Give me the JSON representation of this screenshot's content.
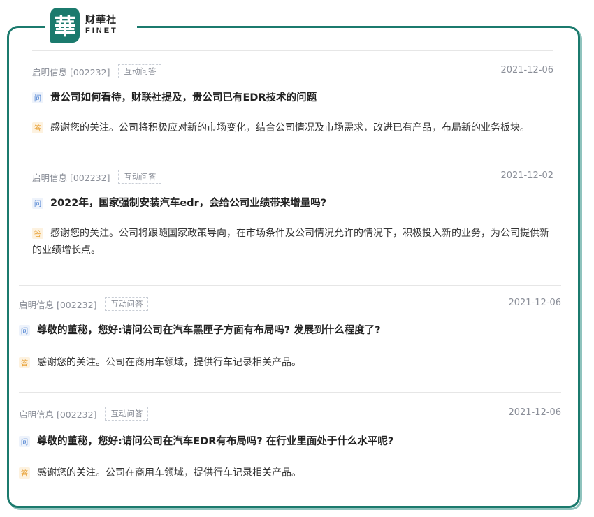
{
  "brand": {
    "mark": "華",
    "name_cn": "财華社",
    "name_en": "FINET"
  },
  "tag_icons": {
    "question": "问",
    "answer": "答"
  },
  "items": [
    {
      "source": "启明信息 [002232]",
      "tag": "互动问答",
      "date": "2021-12-06",
      "question": "贵公司如何看待，财联社提及，贵公司已有EDR技术的问题",
      "answer": "感谢您的关注。公司将积极应对新的市场变化，结合公司情况及市场需求，改进已有产品，布局新的业务板块。"
    },
    {
      "source": "启明信息 [002232]",
      "tag": "互动问答",
      "date": "2021-12-02",
      "question": "2022年，国家强制安装汽车edr，会给公司业绩带来增量吗?",
      "answer": "感谢您的关注。公司将跟随国家政策导向，在市场条件及公司情况允许的情况下，积极投入新的业务，为公司提供新的业绩增长点。"
    },
    {
      "source": "启明信息 [002232]",
      "tag": "互动问答",
      "date": "2021-12-06",
      "question": "尊敬的董秘，您好:请问公司在汽车黑匣子方面有布局吗? 发展到什么程度了?",
      "answer": "感谢您的关注。公司在商用车领域，提供行车记录相关产品。"
    },
    {
      "source": "启明信息 [002232]",
      "tag": "互动问答",
      "date": "2021-12-06",
      "question": "尊敬的董秘，您好:请问公司在汽车EDR有布局吗? 在行业里面处于什么水平呢?",
      "answer": "感谢您的关注。公司在商用车领域，提供行车记录相关产品。"
    }
  ]
}
